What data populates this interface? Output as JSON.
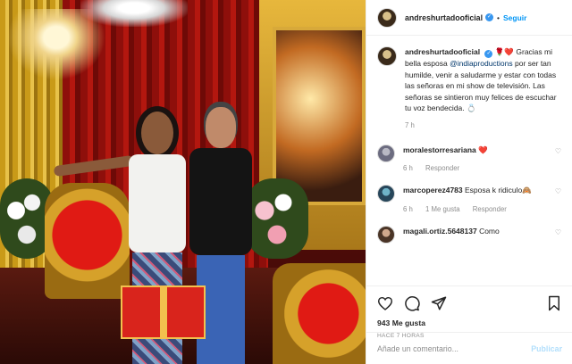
{
  "post": {
    "username": "andreshurtadooficial",
    "verified": true,
    "follow_label": "Seguir",
    "caption": {
      "text_before": "Gracias mi bella esposa ",
      "mention": "@indiaproductions",
      "text_after": " por ser tan humilde, venir a saludarme y estar con todas las señoras en mi show de televisión. Las señoras se sintieron muy felices de escuchar tu voz bendecida. 💍",
      "emoji_prefix": "🌹❤️"
    },
    "caption_time": "7 h"
  },
  "comments": [
    {
      "username": "moralestorresariana",
      "text": "❤️",
      "time": "6 h",
      "reply_label": "Responder",
      "likes_label": ""
    },
    {
      "username": "marcoperez4783",
      "text": "Esposa k ridiculo🙈",
      "time": "6 h",
      "reply_label": "Responder",
      "likes_label": "1 Me gusta"
    },
    {
      "username": "magali.ortiz.5648137",
      "text": "Como",
      "time": "",
      "reply_label": "",
      "likes_label": ""
    }
  ],
  "actions": {
    "icons": [
      "heart-icon",
      "comment-icon",
      "share-icon",
      "bookmark-icon"
    ],
    "likes": "943 Me gusta",
    "time_ago": "HACE 7 HORAS"
  },
  "composer": {
    "placeholder": "Añade un comentario...",
    "publish_label": "Publicar"
  },
  "colors": {
    "accent": "#0095f6",
    "verified": "#3897f0",
    "like_red": "#ed4956",
    "publish_disabled": "#b2dffc"
  }
}
